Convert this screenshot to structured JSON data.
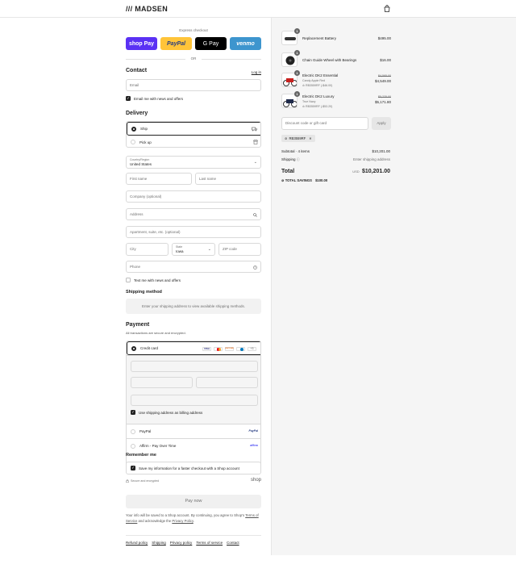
{
  "header": {
    "logo": "/// MADSEN",
    "cart_icon": "bag-icon"
  },
  "express": {
    "title": "Express checkout",
    "or": "OR",
    "buttons": [
      {
        "label": "shop Pay",
        "color": "#5a31f4"
      },
      {
        "label": "PayPal",
        "color": "#ffc439"
      },
      {
        "label": "G Pay",
        "color": "#000000"
      },
      {
        "label": "venmo",
        "color": "#3d95ce"
      }
    ]
  },
  "contact": {
    "title": "Contact",
    "login": "Log in",
    "email_placeholder": "Email",
    "news_label": "Email me with news and offers",
    "news_checked": true
  },
  "delivery": {
    "title": "Delivery",
    "options": [
      {
        "label": "Ship",
        "selected": true,
        "icon": "truck-icon"
      },
      {
        "label": "Pick up",
        "selected": false,
        "icon": "store-icon"
      }
    ],
    "country_label": "Country/Region",
    "country_value": "United States",
    "first_name": "First name",
    "last_name": "Last name",
    "company": "Company (optional)",
    "address": "Address",
    "apartment": "Apartment, suite, etc. (optional)",
    "city": "City",
    "state_label": "State",
    "state_value": "Iowa",
    "zip": "ZIP code",
    "phone": "Phone",
    "text_label": "Text me with news and offers"
  },
  "shipping_method": {
    "title": "Shipping method",
    "note": "Enter your shipping address to view available shipping methods."
  },
  "payment": {
    "title": "Payment",
    "subtitle": "All transactions are secure and encrypted.",
    "credit_card": "Credit card",
    "card_brands": [
      "VISA",
      "MC",
      "DISCOVER",
      "DINERS"
    ],
    "more_brands": "+3",
    "billing_label": "Use shipping address as billing address",
    "paypal": "PayPal",
    "paypal_logo": "PayPal",
    "affirm": "Affirm - Pay Over Time",
    "affirm_logo": "affirm"
  },
  "remember": {
    "title": "Remember me",
    "save_label": "Save my information for a faster checkout with a Shop account",
    "secure": "Secure and encrypted",
    "shop_logo": "shop"
  },
  "pay_now": "Pay now",
  "legal": {
    "line1": "Your info will be saved to a Shop account. By continuing, you agree to Shop's",
    "terms": "Terms of Service",
    "and": " and acknowledge the ",
    "privacy": "Privacy Policy",
    "end": "."
  },
  "footer_links": [
    "Refund policy",
    "Shipping",
    "Privacy policy",
    "Terms of service",
    "Contact"
  ],
  "cart": {
    "items": [
      {
        "name": "Replacement Battery",
        "qty": "1",
        "price": "$495.00"
      },
      {
        "name": "Chain Guide Wheel with Bearings",
        "qty": "1",
        "price": "$16.00"
      },
      {
        "name": "Electric DK2 Essential",
        "qty": "1",
        "variant": "Candy Apple Red",
        "discount": "RB3559RF (-$46.00)",
        "orig_price": "$4,595.00",
        "price": "$4,549.00"
      },
      {
        "name": "Electric DK2 Luxury",
        "qty": "1",
        "variant": "True Navy",
        "discount": "RB3559RF (-$53.20)",
        "orig_price": "$5,225.00",
        "price": "$5,171.80"
      }
    ],
    "discount_placeholder": "Discount code or gift card",
    "apply": "Apply",
    "applied_code": "RB3559RF",
    "subtotal_label": "Subtotal · 4 items",
    "subtotal": "$10,201.00",
    "shipping_label": "Shipping",
    "shipping_value": "Enter shipping address",
    "total_label": "Total",
    "currency": "USD",
    "total": "$10,201.00",
    "savings_label": "TOTAL SAVINGS",
    "savings": "$100.00"
  }
}
